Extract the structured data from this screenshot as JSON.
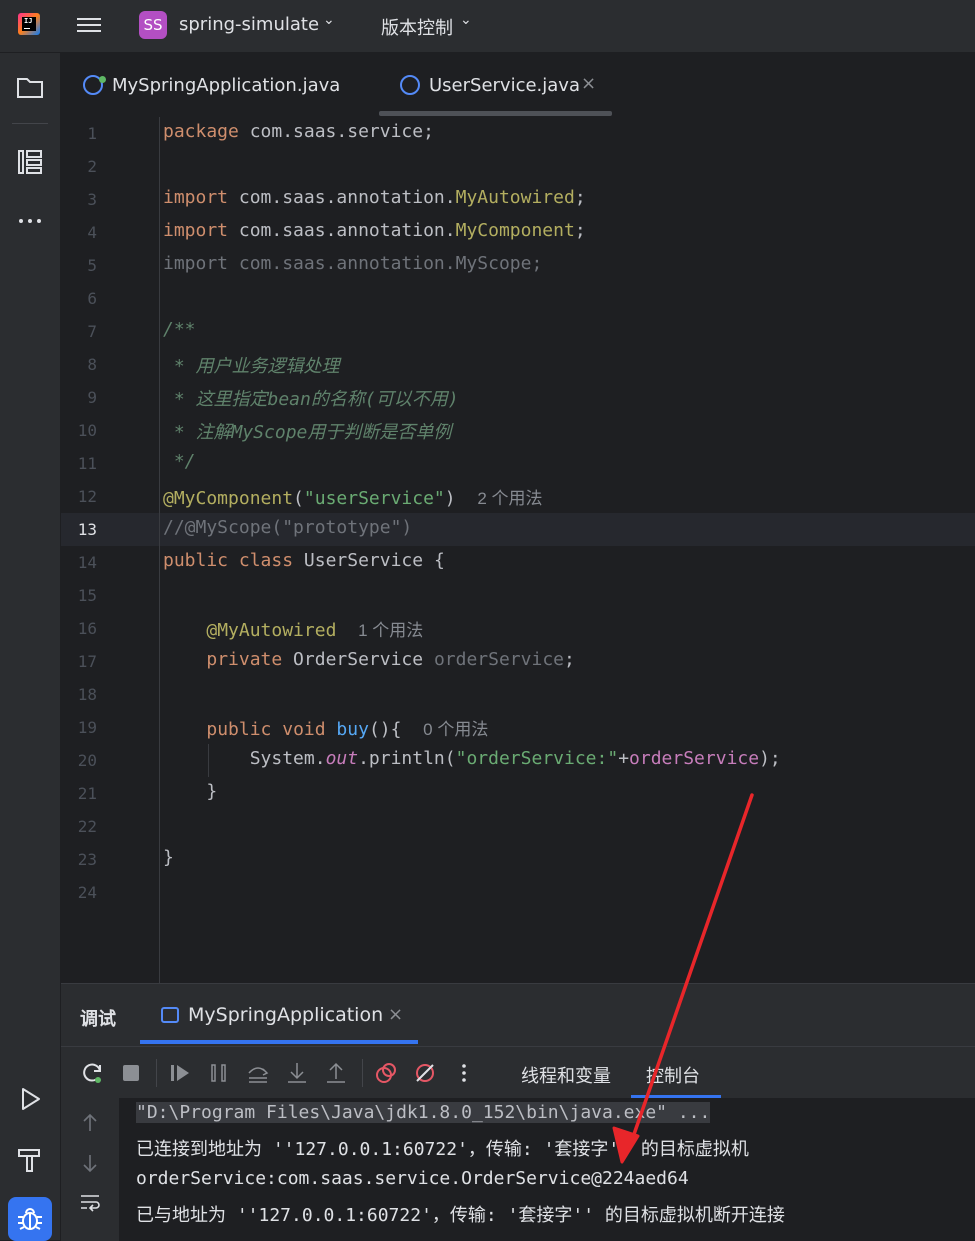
{
  "topbar": {
    "logo_text": "IJ",
    "project_badge": "SS",
    "project_name": "spring-simulate",
    "vcs_label": "版本控制"
  },
  "tabs": [
    {
      "label": "MySpringApplication.java"
    },
    {
      "label": "UserService.java",
      "active": true
    }
  ],
  "editor": {
    "current_line": 13,
    "line_numbers": [
      "1",
      "2",
      "3",
      "4",
      "5",
      "6",
      "7",
      "8",
      "9",
      "10",
      "11",
      "12",
      "13",
      "14",
      "15",
      "16",
      "17",
      "18",
      "19",
      "20",
      "21",
      "22",
      "23",
      "24"
    ],
    "line1": {
      "kw": "package",
      "rest": " com.saas.service;"
    },
    "line3": {
      "kw": "import",
      "pkg": " com.saas.annotation.",
      "cls": "MyAutowired",
      "end": ";"
    },
    "line4": {
      "kw": "import",
      "pkg": " com.saas.annotation.",
      "cls": "MyComponent",
      "end": ";"
    },
    "line5": {
      "text": "import com.saas.annotation.MyScope;"
    },
    "line7": "/**",
    "line8": " * 用户业务逻辑处理",
    "line9": " * 这里指定bean的名称(可以不用)",
    "line10": " * 注解MyScope用于判断是否单例",
    "line11": " */",
    "line12": {
      "ann": "@MyComponent",
      "open": "(",
      "str": "\"userService\"",
      "close": ")",
      "hint": "2 个用法"
    },
    "line13": {
      "text": "//@MyScope(\"prototype\")"
    },
    "line14": {
      "kw1": "public",
      "kw2": " class",
      "rest": " UserService {"
    },
    "line16": {
      "ann": "@MyAutowired",
      "hint": "1 个用法"
    },
    "line17": {
      "kw": "private",
      "type": " OrderService",
      "field": " orderService",
      "end": ";"
    },
    "line19": {
      "kw1": "public",
      "kw2": " void",
      "fn": " buy",
      "rest": "(){",
      "hint": "0 个用法"
    },
    "line20": {
      "pre": "System.",
      "out": "out",
      "mid": ".println(",
      "str": "\"orderService:\"",
      "plus": "+",
      "field": "orderService",
      "end": ");"
    },
    "line21": "}",
    "line23": "}"
  },
  "panel": {
    "title": "调试",
    "session_tab": "MySpringApplication",
    "subtab_vars": "线程和变量",
    "subtab_console": "控制台"
  },
  "console": {
    "lines": [
      "\"D:\\Program Files\\Java\\jdk1.8.0_152\\bin\\java.exe\" ...",
      "已连接到地址为 ''127.0.0.1:60722'，传输: '套接字'' 的目标虚拟机",
      "orderService:com.saas.service.OrderService@224aed64",
      "已与地址为 ''127.0.0.1:60722'，传输: '套接字'' 的目标虚拟机断开连接"
    ]
  },
  "icons": {
    "close": "×",
    "chevron": "⌄",
    "more": "⋮"
  },
  "colors": {
    "accent": "#3574f0",
    "annotation": "#b3ae60",
    "keyword": "#cf8e6d",
    "string": "#6aab73",
    "arrow": "#e8262a"
  }
}
